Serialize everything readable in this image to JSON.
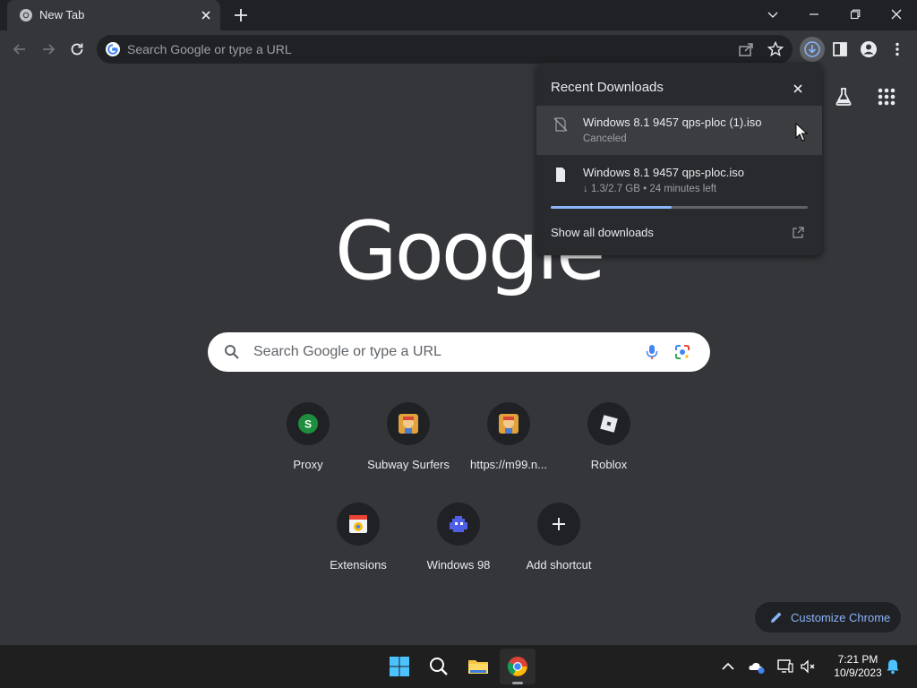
{
  "browser": {
    "tab": {
      "title": "New Tab",
      "icon": "chrome-icon"
    },
    "omnibox": {
      "placeholder": "Search Google or type a URL"
    }
  },
  "downloads": {
    "title": "Recent Downloads",
    "items": [
      {
        "filename": "Windows 8.1 9457 qps-ploc (1).iso",
        "status": "Canceled",
        "icon": "download-canceled-icon"
      },
      {
        "filename": "Windows 8.1 9457 qps-ploc.iso",
        "status": "↓ 1.3/2.7 GB • 24 minutes left",
        "icon": "file-icon",
        "progress": 0.47
      }
    ],
    "show_all": "Show all downloads"
  },
  "ntp": {
    "logo": "Google",
    "search_placeholder": "Search Google or type a URL",
    "shortcuts": [
      {
        "label": "Proxy",
        "icon": "proxy-letter-icon",
        "letter": "S"
      },
      {
        "label": "Subway Surfers",
        "icon": "subway-surfers-icon"
      },
      {
        "label": "https://m99.n...",
        "icon": "subway-surfers-icon"
      },
      {
        "label": "Roblox",
        "icon": "roblox-icon"
      },
      {
        "label": "Extensions",
        "icon": "extensions-icon"
      },
      {
        "label": "Windows 98",
        "icon": "windows98-icon"
      },
      {
        "label": "Add shortcut",
        "icon": "plus-icon"
      }
    ],
    "customize_label": "Customize Chrome"
  },
  "taskbar": {
    "time": "7:21 PM",
    "date": "10/9/2023"
  },
  "colors": {
    "page_bg": "#35363a",
    "titlebar_bg": "#202124",
    "accent": "#8ab4f8",
    "taskbar_bg": "#1f1f1f"
  }
}
